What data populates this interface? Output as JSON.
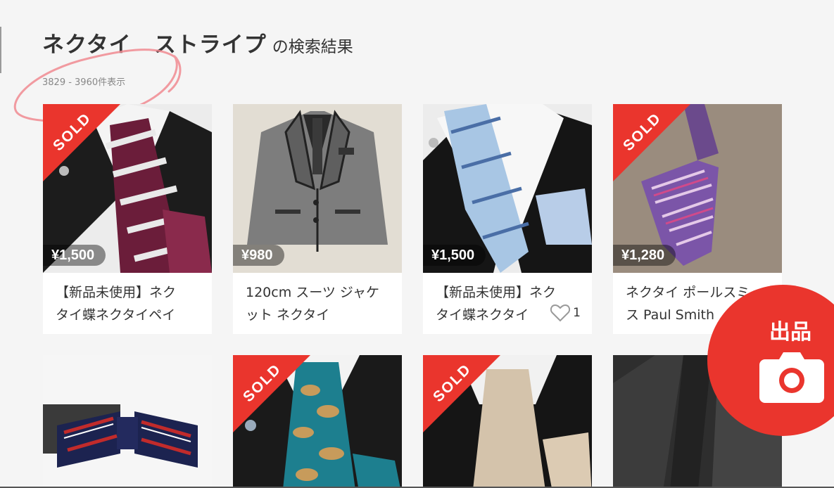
{
  "header": {
    "query": "ネクタイ　ストライプ",
    "suffix": "の検索結果",
    "count": "3829 - 3960件表示"
  },
  "items": [
    {
      "sold": true,
      "sold_label": "SOLD",
      "price": "¥1,500",
      "name_line1": "【新品未使用】ネク",
      "name_line2": "タイ蝶ネクタイペイ",
      "icon": "burgundy-striped-tie-photo"
    },
    {
      "sold": false,
      "price": "¥980",
      "name_line1": "120cm スーツ ジャケ",
      "name_line2": "ット ネクタイ",
      "icon": "grey-kids-jacket-photo"
    },
    {
      "sold": false,
      "price": "¥1,500",
      "name_line1": "【新品未使用】ネク",
      "name_line2": "タイ蝶ネクタイ",
      "likes": "1",
      "icon": "blue-striped-tie-photo"
    },
    {
      "sold": true,
      "sold_label": "SOLD",
      "price": "¥1,280",
      "name_line1": "ネクタイ ポールスミ",
      "name_line2": "ス Paul Smith",
      "icon": "purple-stripe-tie-photo"
    },
    {
      "sold": false,
      "icon": "navy-red-bowtie-photo"
    },
    {
      "sold": true,
      "sold_label": "SOLD",
      "icon": "teal-paisley-tie-photo"
    },
    {
      "sold": true,
      "sold_label": "SOLD",
      "icon": "champagne-tie-photo"
    },
    {
      "sold": false,
      "icon": "dark-suit-photo"
    }
  ],
  "fab": {
    "label": "出品",
    "icon": "camera-icon"
  },
  "colors": {
    "accent": "#ea352d",
    "background": "#f5f5f5"
  }
}
